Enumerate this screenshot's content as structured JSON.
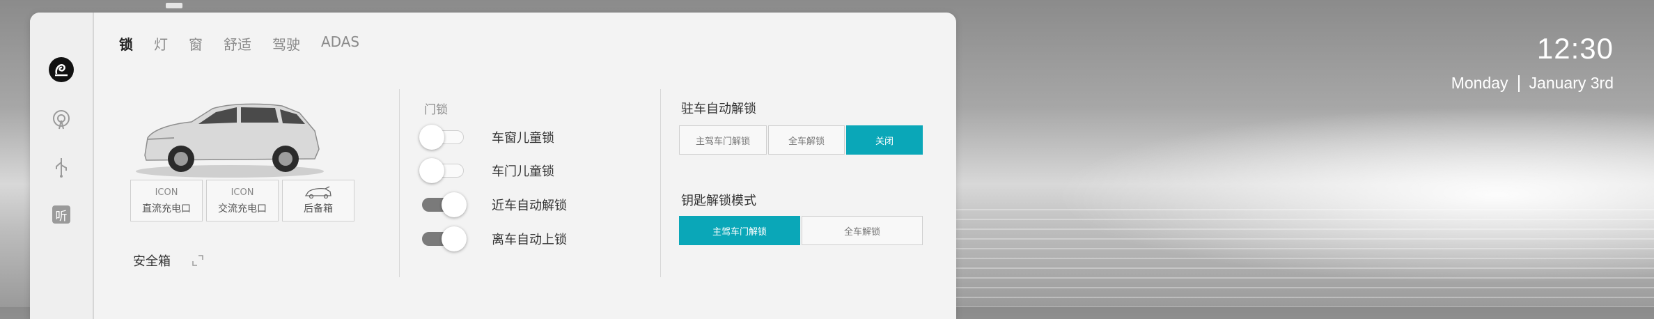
{
  "tabs": [
    {
      "label": "锁",
      "active": true
    },
    {
      "label": "灯",
      "active": false
    },
    {
      "label": "窗",
      "active": false
    },
    {
      "label": "舒适",
      "active": false
    },
    {
      "label": "驾驶",
      "active": false
    },
    {
      "label": "ADAS",
      "active": false
    }
  ],
  "sidebar": {
    "items": [
      {
        "icon": "nio-logo-icon"
      },
      {
        "icon": "radio-icon"
      },
      {
        "icon": "usb-icon"
      },
      {
        "icon": "listen-icon",
        "glyph": "听"
      }
    ]
  },
  "vehicle": {
    "features": [
      {
        "icon_text": "ICON",
        "label": "直流充电口"
      },
      {
        "icon_text": "ICON",
        "label": "交流充电口"
      },
      {
        "icon": "trunk-icon",
        "label": "后备箱"
      }
    ],
    "safe_label": "安全箱"
  },
  "door_lock": {
    "title": "门锁",
    "toggles": [
      {
        "label": "车窗儿童锁",
        "on": false
      },
      {
        "label": "车门儿童锁",
        "on": false
      },
      {
        "label": "近车自动解锁",
        "on": true
      },
      {
        "label": "离车自动上锁",
        "on": true
      }
    ]
  },
  "park_unlock": {
    "title": "驻车自动解锁",
    "options": [
      "主驾车门解锁",
      "全车解锁",
      "关闭"
    ],
    "selected": "关闭"
  },
  "key_unlock": {
    "title": "钥匙解锁模式",
    "options": [
      "主驾车门解锁",
      "全车解锁"
    ],
    "selected": "主驾车门解锁"
  },
  "status": {
    "time": "12:30",
    "weekday": "Monday",
    "date": "January 3rd"
  },
  "colors": {
    "accent": "#0aa7b8",
    "toggle_on": "#7a7a7a"
  }
}
